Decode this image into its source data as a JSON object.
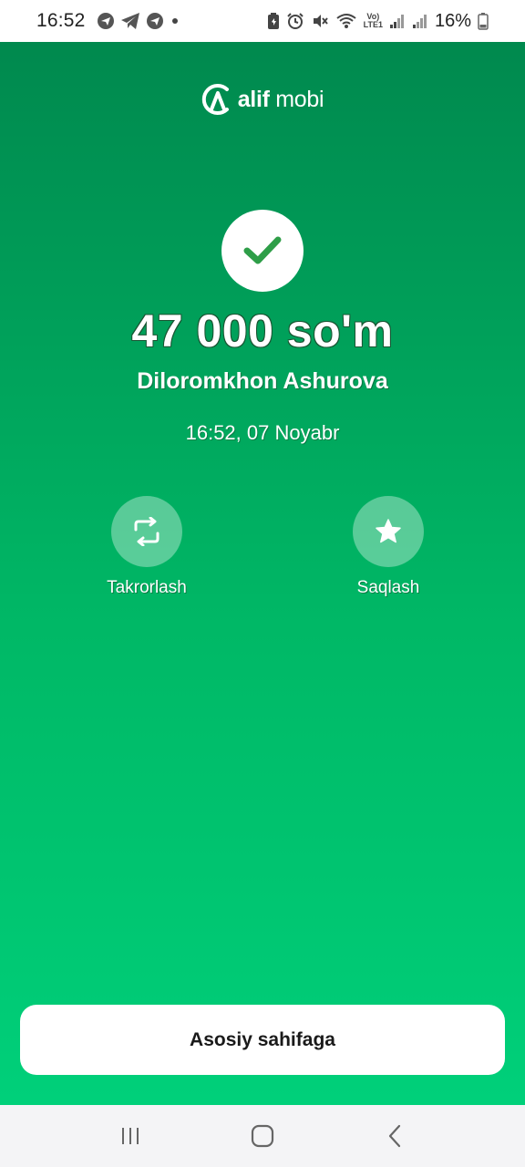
{
  "status_bar": {
    "time": "16:52",
    "battery_percent": "16%",
    "left_icons": [
      "chat-app-icon",
      "telegram-icon",
      "chat-app-icon",
      "dot-icon"
    ],
    "right_icons": [
      "battery-saver-icon",
      "alarm-icon",
      "mute-icon",
      "wifi-icon",
      "volte-icon",
      "signal-icon",
      "signal-icon",
      "battery-icon"
    ],
    "volte_label_top": "Vo)",
    "volte_label_bottom": "LTE1"
  },
  "brand": {
    "logo_icon": "alif-logo-icon",
    "name_bold": "alif",
    "name_light": "mobi"
  },
  "result": {
    "status_icon": "check-icon",
    "amount": "47 000 so'm",
    "recipient": "Diloromkhon Ashurova",
    "datetime": "16:52, 07 Noyabr"
  },
  "actions": [
    {
      "label": "Takrorlash",
      "icon": "repeat-icon"
    },
    {
      "label": "Saqlash",
      "icon": "star-icon"
    }
  ],
  "footer": {
    "home_button_label": "Asosiy sahifaga"
  },
  "nav_bar": {
    "buttons": [
      "recent-apps-icon",
      "home-icon",
      "back-icon"
    ]
  },
  "colors": {
    "gradient_top": "#00894e",
    "gradient_bottom": "#00d07a",
    "check_green": "#2e9e48",
    "white": "#ffffff"
  }
}
